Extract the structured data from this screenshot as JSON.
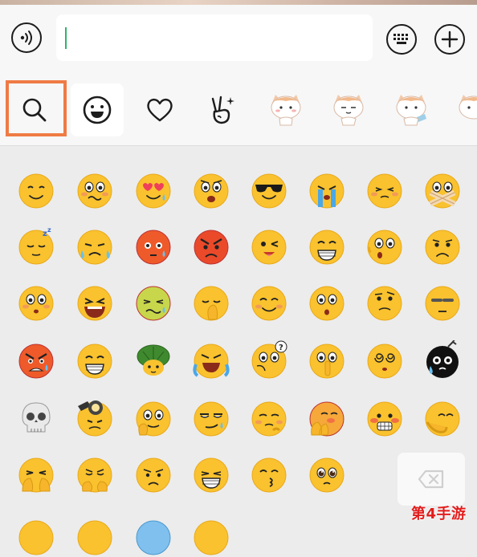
{
  "input_bar": {
    "text_value": "",
    "left_button": "voice-input",
    "right_buttons": [
      "keyboard",
      "more-plus"
    ]
  },
  "tabs": [
    {
      "icon": "search-icon",
      "active": false,
      "highlighted": true
    },
    {
      "icon": "smiley-icon",
      "active": true
    },
    {
      "icon": "heart-icon",
      "active": false
    },
    {
      "icon": "victory-hand-icon",
      "active": false
    },
    {
      "icon": "cat-sticker-1",
      "active": false
    },
    {
      "icon": "cat-sticker-2",
      "active": false
    },
    {
      "icon": "cat-sticker-3",
      "active": false
    },
    {
      "icon": "cat-sticker-4",
      "active": false
    }
  ],
  "emoji_grid": [
    [
      "smile",
      "awkward",
      "heart-eyes",
      "stare",
      "cool",
      "bawl",
      "shy",
      "shut-mouth"
    ],
    [
      "sleep",
      "cry",
      "angry-red",
      "mad",
      "wink",
      "grin",
      "surprised",
      "frown"
    ],
    [
      "blush-wonder",
      "lol",
      "sick",
      "facepalm",
      "happy",
      "shocked",
      "thinking",
      "speechless"
    ],
    [
      "furious",
      "giggle",
      "turtle",
      "sob-laugh",
      "question",
      "shush",
      "dizzy",
      "bomb-face"
    ],
    [
      "skull",
      "hammer",
      "chin-touch",
      "smirk",
      "pout",
      "blush-hands",
      "teeth",
      "hug"
    ],
    [
      "cover-mouth",
      "sad-hands",
      "sigh",
      "hehe",
      "kiss",
      "pleading",
      "",
      ""
    ]
  ],
  "backspace": "backspace-key",
  "watermark": "第4手游",
  "colors": {
    "accent_highlight": "#ef7b45",
    "caret": "#2fb36b",
    "emoji_yellow": "#f9c22e",
    "watermark_red": "#e21c1c"
  }
}
